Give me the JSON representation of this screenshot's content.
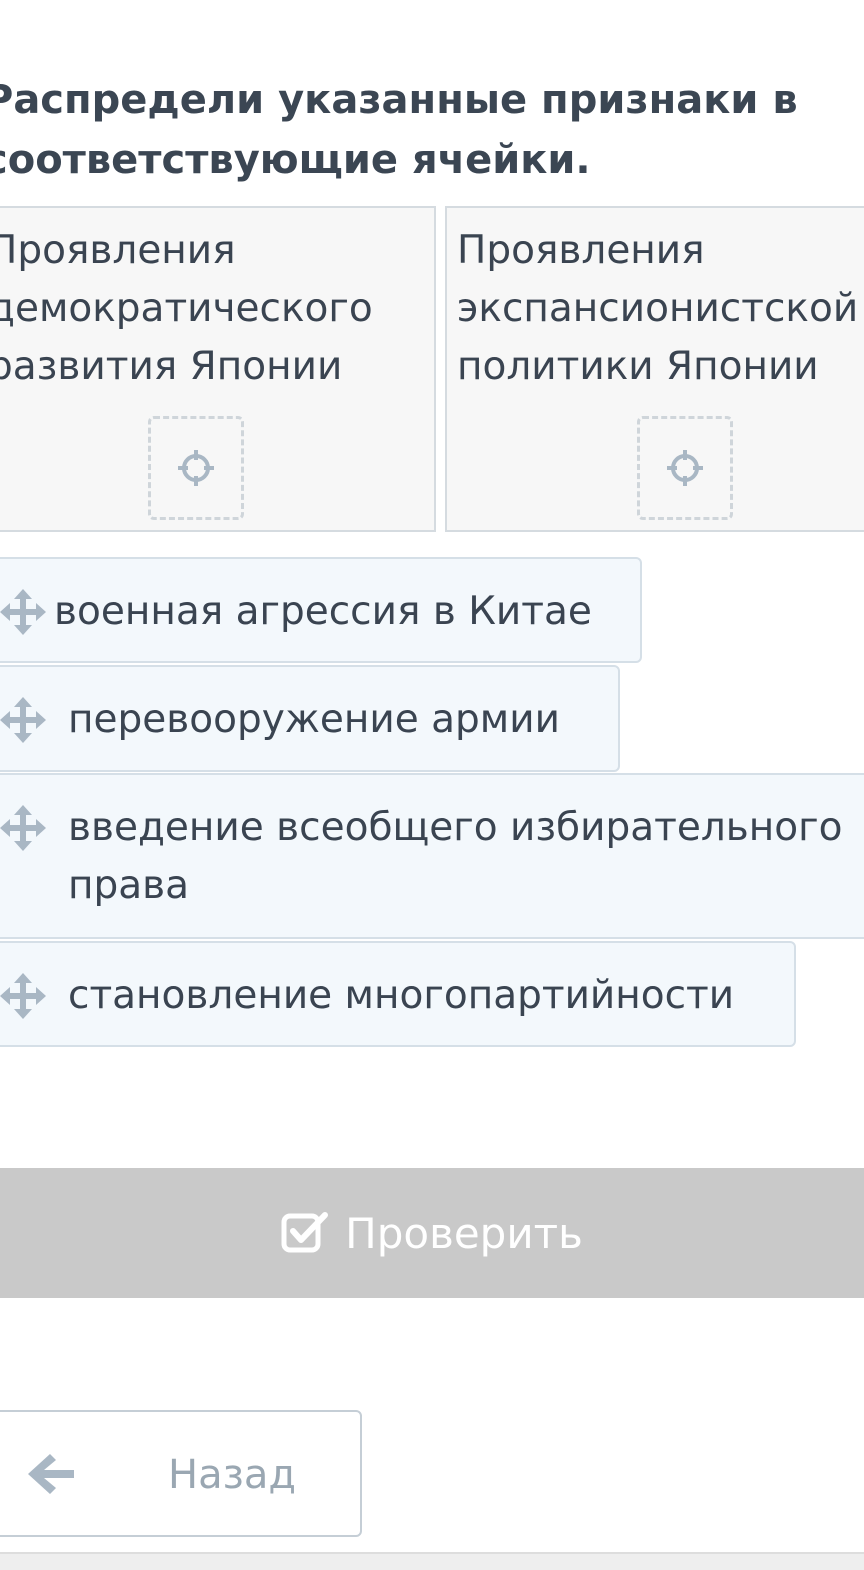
{
  "question": {
    "text": "Распредели указанные признаки в соответствующие ячейки."
  },
  "categories": [
    {
      "label": "Проявления\nдемократического\nразвития Японии",
      "drop_icon": "crosshair-icon"
    },
    {
      "label": "Проявления\nэкспансионистской\nполитики Японии",
      "drop_icon": "crosshair-icon"
    }
  ],
  "items": [
    {
      "label": "военная агрессия в Китае",
      "icon": "move-icon"
    },
    {
      "label": "перевооружение армии",
      "icon": "move-icon"
    },
    {
      "label": "введение всеобщего избирательного\nправа",
      "icon": "move-icon"
    },
    {
      "label": "становление многопартийности",
      "icon": "move-icon"
    }
  ],
  "check_button": {
    "label": "Проверить",
    "icon": "checkbox-check-icon",
    "bar_color": "#c9c9c9"
  },
  "back_button": {
    "label": "Назад",
    "icon": "arrow-left-icon"
  },
  "colors": {
    "text": "#3a4451",
    "icon": "#a9b7c4",
    "cell_bg": "#f7f7f7",
    "item_bg": "#f3f8fc"
  }
}
